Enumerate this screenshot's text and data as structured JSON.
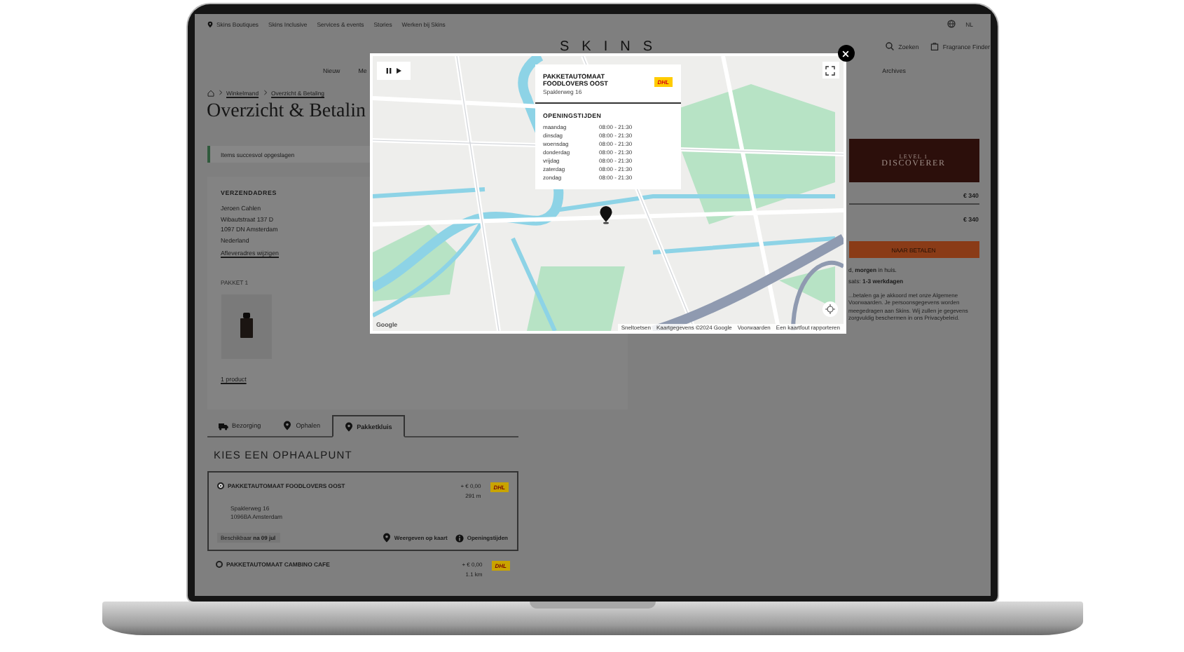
{
  "top_bar": {
    "links": [
      "Skins Boutiques",
      "Skins Inclusive",
      "Services & events",
      "Stories",
      "Werken bij Skins"
    ],
    "language": "NL"
  },
  "header": {
    "logo": "SKINS",
    "search": "Zoeken",
    "fragrance_finder": "Fragrance Finder"
  },
  "nav": {
    "items": [
      "Nieuw",
      "Me",
      "Archives"
    ]
  },
  "breadcrumb": [
    "Winkelmand",
    "Overzicht & Betaling"
  ],
  "page_title": "Overzicht & Betalin",
  "notice": "Items succesvol opgeslagen",
  "shipping_address": {
    "heading": "VERZENDADRES",
    "lines": [
      "Jeroen Cahlen",
      "Wibautstraat 137 D",
      "1097 DN Amsterdam",
      "Nederland"
    ],
    "link": "Afleveradres wijzigen"
  },
  "package": {
    "label": "PAKKET 1",
    "product_link": "1 product"
  },
  "delivery_tabs": [
    {
      "label": "Bezorging",
      "kind": "truck",
      "selected": false
    },
    {
      "label": "Ophalen",
      "kind": "pin",
      "selected": false
    },
    {
      "label": "Pakketkluis",
      "kind": "pin",
      "selected": true
    }
  ],
  "pickup": {
    "heading": "KIES EEN OPHAALPUNT",
    "options": [
      {
        "name": "PAKKETAUTOMAAT FOODLOVERS OOST",
        "selected": true,
        "price": "+ € 0,00",
        "distance": "291 m",
        "carrier": "DHL",
        "address_lines": [
          "Spaklerweg 16",
          "1096BA Amsterdam"
        ],
        "availability": "Beschikbaar **na 09 jul**",
        "actions": [
          "Weergeven op kaart",
          "Openingstijden"
        ]
      },
      {
        "name": "PAKKETAUTOMAAT CAMBINO CAFE",
        "selected": false,
        "price": "+ € 0,00",
        "distance": "1.1 km",
        "carrier": "DHL"
      }
    ]
  },
  "summary": {
    "level": "LEVEL 1",
    "tier": "DISCOVERER",
    "rows": [
      "€ 340",
      "€ 340"
    ],
    "button": "NAAR BETALEN",
    "delivery_lines": [
      "d, **morgen** in huis.",
      "sats: **1-3 werkdagen**"
    ],
    "legal": "...betalen ga je akkoord met onze Algemene Voorwaarden. Je persoonsgegevens worden meegedragen aan Skins. Wij zullen je gegevens zorgvuldig beschermen in ons Privacybeleid."
  },
  "map_modal": {
    "info": {
      "title": "PAKKETAUTOMAAT FOODLOVERS OOST",
      "address": "Spaklerweg 16",
      "carrier": "DHL",
      "heading": "OPENINGSTIJDEN",
      "hours": [
        {
          "day": "maandag",
          "time": "08:00 - 21:30"
        },
        {
          "day": "dinsdag",
          "time": "08:00 - 21:30"
        },
        {
          "day": "woensdag",
          "time": "08:00 - 21:30"
        },
        {
          "day": "donderdag",
          "time": "08:00 - 21:30"
        },
        {
          "day": "vrijdag",
          "time": "08:00 - 21:30"
        },
        {
          "day": "zaterdag",
          "time": "08:00 - 21:30"
        },
        {
          "day": "zondag",
          "time": "08:00 - 21:30"
        }
      ]
    },
    "map_logo": "Google",
    "attribution": [
      "Sneltoetsen",
      "Kaartgegevens ©2024 Google",
      "Voorwaarden",
      "Een kaartfout rapporteren"
    ]
  }
}
